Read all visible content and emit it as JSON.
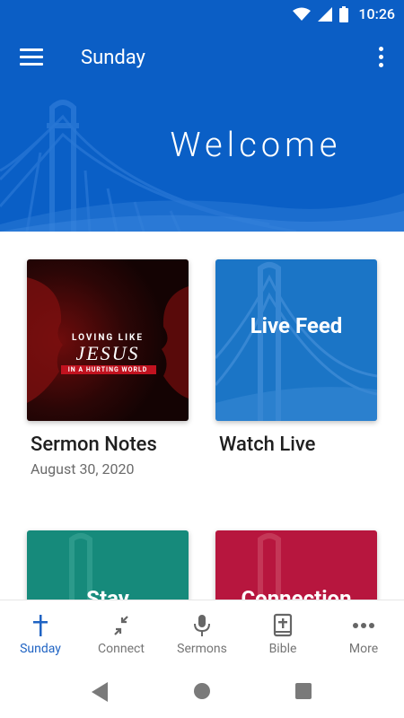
{
  "status": {
    "time": "10:26"
  },
  "appbar": {
    "title": "Sunday",
    "menu_icon": "hamburger-menu-icon",
    "overflow_icon": "more-vert-icon"
  },
  "hero": {
    "title": "Welcome"
  },
  "cards": {
    "sermon": {
      "title": "Sermon Notes",
      "subtitle": "August 30, 2020",
      "art_line1": "LOVING LIKE",
      "art_line2": "JESUS",
      "art_line3": "IN A HURTING WORLD"
    },
    "live": {
      "title": "Watch Live",
      "overlay": "Live Feed"
    },
    "stay": {
      "overlay": "Stay"
    },
    "connection": {
      "overlay": "Connection"
    }
  },
  "colors": {
    "primary": "#0b5ec5",
    "live_card": "#1b75c6",
    "stay_card": "#168a7b",
    "connection_card": "#b7163e",
    "active_nav": "#1f63c3"
  },
  "nav": [
    {
      "label": "Sunday",
      "icon": "cross-icon",
      "active": true
    },
    {
      "label": "Connect",
      "icon": "connect-arrows-icon",
      "active": false
    },
    {
      "label": "Sermons",
      "icon": "microphone-icon",
      "active": false
    },
    {
      "label": "Bible",
      "icon": "bible-icon",
      "active": false
    },
    {
      "label": "More",
      "icon": "more-horiz-icon",
      "active": false
    }
  ]
}
